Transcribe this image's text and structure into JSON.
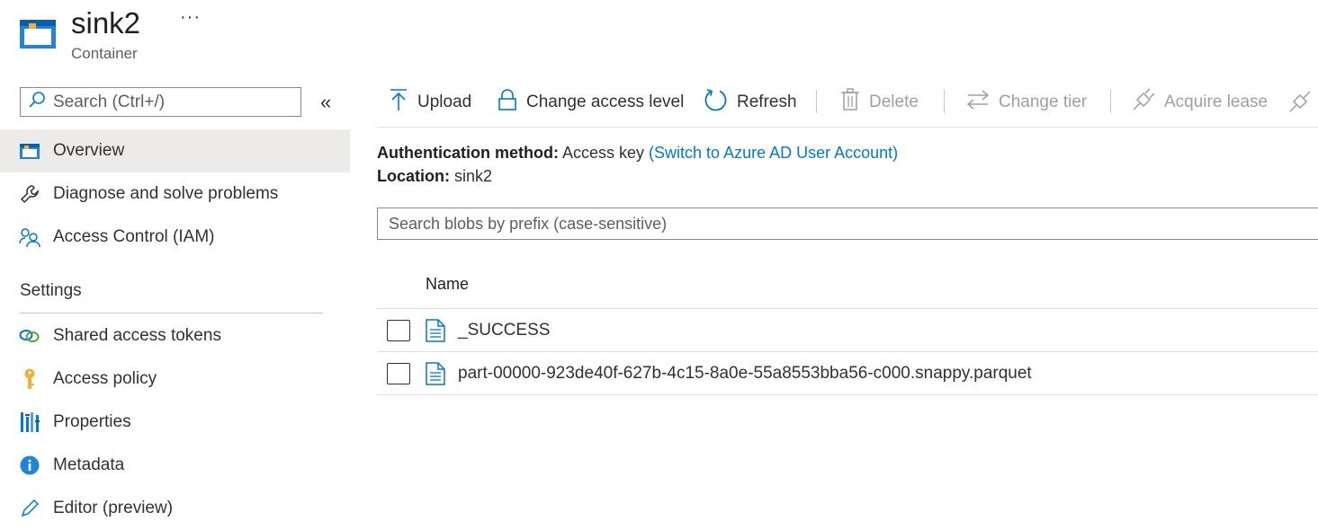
{
  "header": {
    "title": "sink2",
    "subtitle": "Container",
    "more_label": "···"
  },
  "sidebar": {
    "search_placeholder": "Search (Ctrl+/)",
    "collapse_label": "«",
    "items": [
      {
        "label": "Overview",
        "icon": "container-icon"
      },
      {
        "label": "Diagnose and solve problems",
        "icon": "wrench-icon"
      },
      {
        "label": "Access Control (IAM)",
        "icon": "people-icon"
      }
    ],
    "section_label": "Settings",
    "settings_items": [
      {
        "label": "Shared access tokens",
        "icon": "link-icon"
      },
      {
        "label": "Access policy",
        "icon": "key-icon"
      },
      {
        "label": "Properties",
        "icon": "bars-icon"
      },
      {
        "label": "Metadata",
        "icon": "info-icon"
      },
      {
        "label": "Editor (preview)",
        "icon": "pencil-icon"
      }
    ]
  },
  "toolbar": {
    "upload": "Upload",
    "change_access": "Change access level",
    "refresh": "Refresh",
    "delete": "Delete",
    "change_tier": "Change tier",
    "acquire_lease": "Acquire lease"
  },
  "info": {
    "auth_label": "Authentication method:",
    "auth_value": "Access key",
    "auth_link": "(Switch to Azure AD User Account)",
    "location_label": "Location:",
    "location_value": "sink2"
  },
  "blob_search": {
    "placeholder": "Search blobs by prefix (case-sensitive)"
  },
  "table": {
    "header_name": "Name",
    "rows": [
      {
        "name": "_SUCCESS"
      },
      {
        "name": "part-00000-923de40f-627b-4c15-8a0e-55a8553bba56-c000.snappy.parquet"
      }
    ]
  },
  "colors": {
    "accent": "#0078d4",
    "selected_bg": "#edebe9",
    "disabled_text": "#a19f9d"
  }
}
